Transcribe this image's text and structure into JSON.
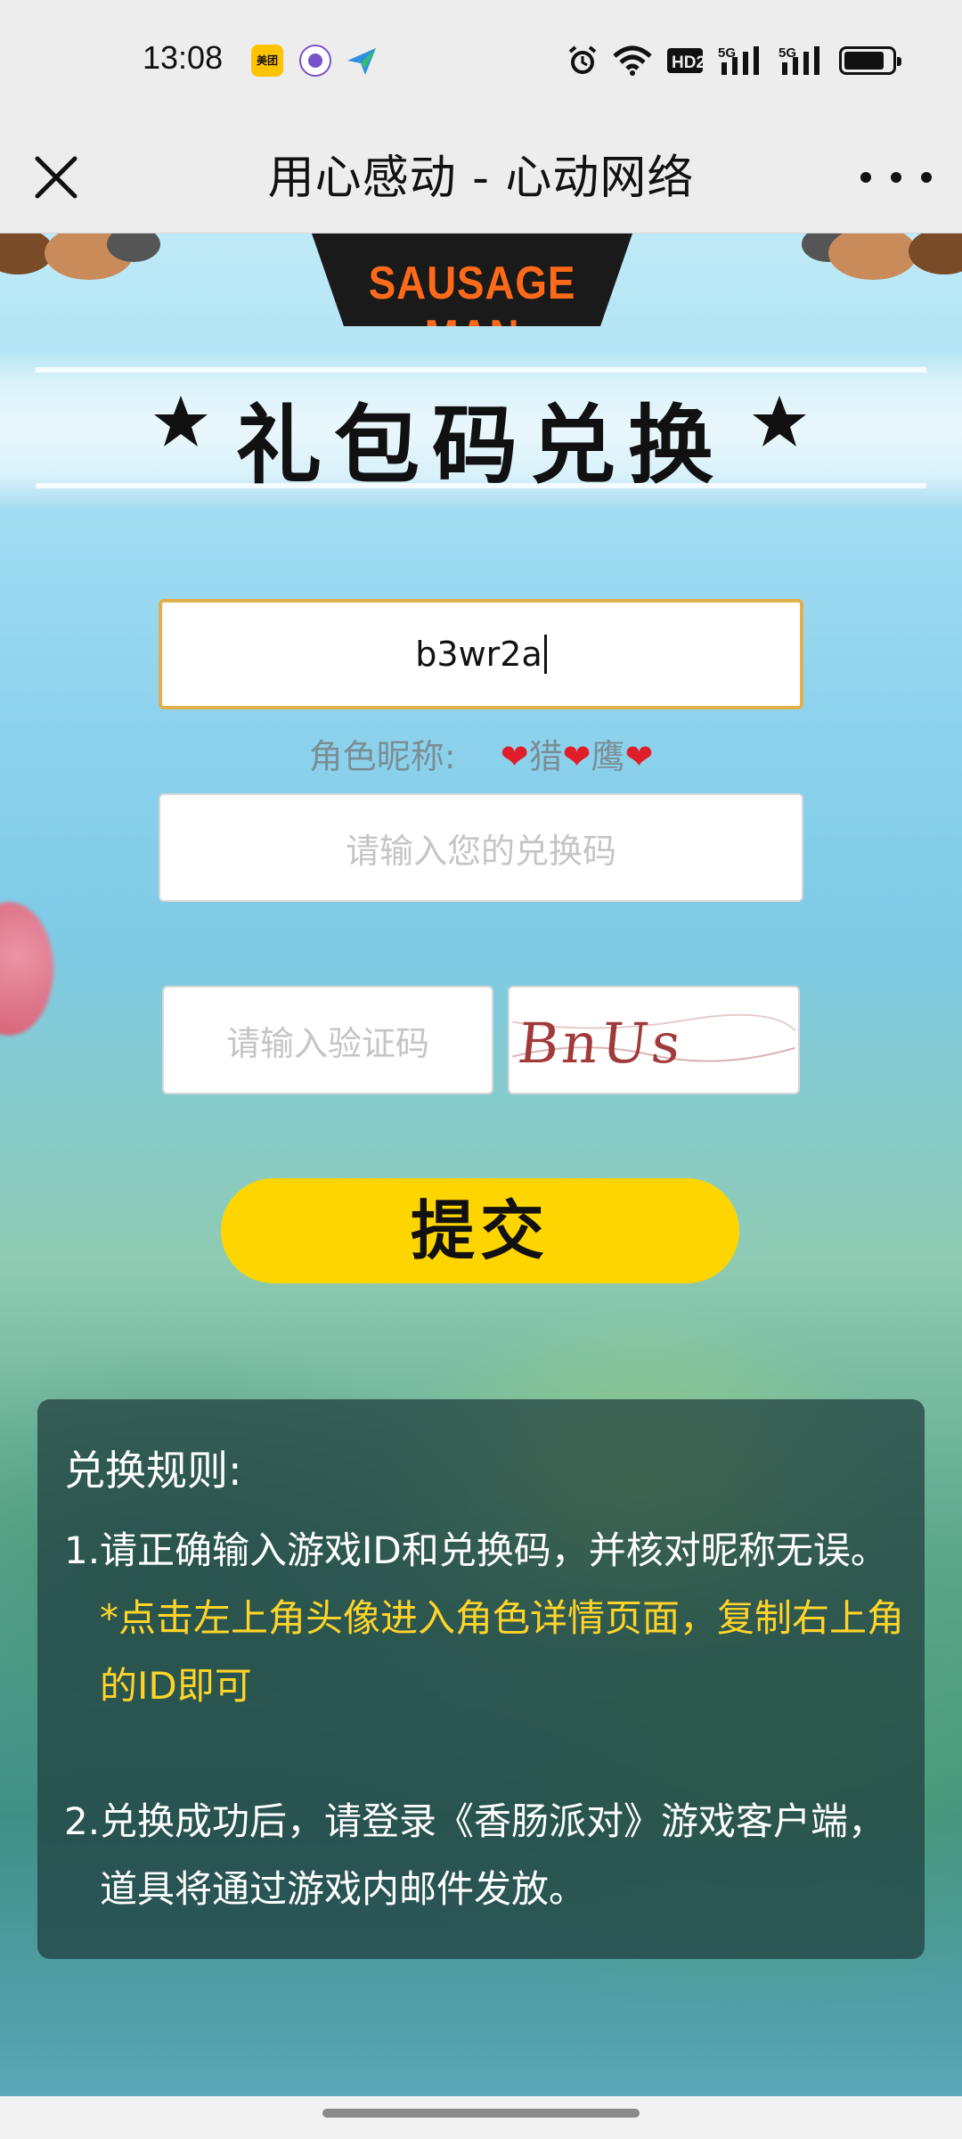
{
  "status_bar": {
    "time": "13:08",
    "meituan_label": "美团",
    "network": "HD2",
    "signal1": "5G",
    "signal2": "5G",
    "icons": [
      "meituan-icon",
      "purple-app-icon",
      "paper-plane-icon",
      "alarm-icon",
      "wifi-icon",
      "hd-icon",
      "signal-5g-icon",
      "signal-5g-icon",
      "battery-icon"
    ]
  },
  "title_bar": {
    "title": "用心感动 - 心动网络"
  },
  "banner": {
    "logo": "SAUSAGE MAN",
    "heading": "礼包码兑换"
  },
  "form": {
    "game_id_value": "b3wr2a",
    "nickname_label": "角色昵称:",
    "nickname_heart": "❤",
    "nickname_part1": "猎",
    "nickname_part2": "鹰",
    "redeem_placeholder": "请输入您的兑换码",
    "captcha_placeholder": "请输入验证码",
    "captcha_text": "BnUs",
    "submit_label": "提交"
  },
  "rules": {
    "title": "兑换规则:",
    "items": [
      {
        "num": "1.",
        "text": "请正确输入游戏ID和兑换码，并核对昵称无误。",
        "hint": "*点击左上角头像进入角色详情页面，复制右上角的ID即可"
      },
      {
        "num": "2.",
        "text": "兑换成功后，请登录《香肠派对》游戏客户端，道具将通过游戏内邮件发放。"
      }
    ]
  },
  "colors": {
    "accent_yellow": "#ffd500",
    "hint_yellow": "#ffd42a",
    "heart_red": "#e01e2a",
    "input_focus_border": "#e0b04d"
  }
}
